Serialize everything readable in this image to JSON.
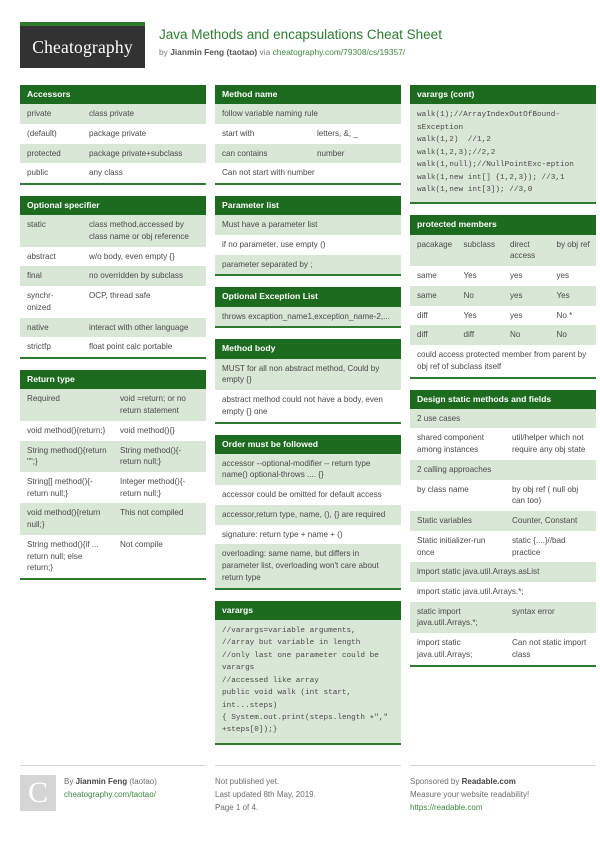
{
  "header": {
    "logo_text": "Cheatography",
    "title": "Java Methods and encapsulations Cheat Sheet",
    "by_prefix": "by ",
    "author": "Jianmin Feng (taotao)",
    "via": " via ",
    "source_url": "cheatography.com/79308/cs/19357/"
  },
  "columns": [
    {
      "blocks": [
        {
          "title": "Accessors",
          "type": "kv",
          "rows": [
            [
              "private",
              "class private"
            ],
            [
              "(default)",
              "package private"
            ],
            [
              "protected",
              "package private+subclass"
            ],
            [
              "public",
              "any class"
            ]
          ]
        },
        {
          "title": "Optional specifier",
          "type": "kv",
          "rows": [
            [
              "static",
              "class method,accessed by class name or obj reference"
            ],
            [
              "abstract",
              "w/o body, even empty {}"
            ],
            [
              "final",
              "no overridden by subclass"
            ],
            [
              "synchr-onized",
              "OCP, thread safe"
            ],
            [
              "native",
              "interact with other language"
            ],
            [
              "strictfp",
              "float point calc portable"
            ]
          ]
        },
        {
          "title": "Return type",
          "type": "half",
          "rows": [
            [
              "Required",
              "void =return; or no return statement"
            ],
            [
              "void method(){return;}",
              "void method(){}"
            ],
            [
              "String method(){return \"\";}",
              "String method(){-return null;}"
            ],
            [
              "String[] method(){-return null;}",
              "Integer method(){-return null;}"
            ],
            [
              "void method(){return null;}",
              "This not compiled"
            ],
            [
              "String method(){if ... return null; else return;}",
              "Not compile"
            ]
          ]
        }
      ]
    },
    {
      "blocks": [
        {
          "title": "Method name",
          "type": "mixed",
          "rows": [
            [
              "follow variable naming rule",
              ""
            ],
            [
              "start with",
              "letters, &, _"
            ],
            [
              "can contains",
              "number"
            ],
            [
              "Can not start with number",
              ""
            ]
          ]
        },
        {
          "title": "Parameter list",
          "type": "full",
          "rows": [
            [
              "Must have a parameter list"
            ],
            [
              "if no parameter, use empty ()"
            ],
            [
              "parameter separated by ;"
            ]
          ]
        },
        {
          "title": "Optional Exception List",
          "type": "full",
          "rows": [
            [
              "throws excaption_name1,exception_name-2,..."
            ]
          ]
        },
        {
          "title": "Method body",
          "type": "full",
          "rows": [
            [
              "MUST for all non abstract method, Could by empty {}"
            ],
            [
              "abstract method could not have a body, even empty {} one"
            ]
          ]
        },
        {
          "title": "Order must be followed",
          "type": "full",
          "rows": [
            [
              "accessor --optional-modifier -- return type name() optional-throws .... {}"
            ],
            [
              "accessor could be omitted for default access"
            ],
            [
              "accessor,return type, name, (), {} are required"
            ],
            [
              "signature: return type + name + ()"
            ],
            [
              "overloading: same name, but differs in parameter list, overloading won't care about return type"
            ]
          ]
        },
        {
          "title": "varargs",
          "type": "code",
          "code": "//varargs=variable arguments,\n//array but variable in length\n//only last one parameter could be varargs\n//accessed like array\npublic void walk (int start, int...steps)\n{ System.out.print(steps.length +\",\" +steps[0]);}"
        }
      ]
    },
    {
      "blocks": [
        {
          "title": "varargs (cont)",
          "type": "code",
          "code": "walk(1);//ArrayIndexOutOfBound-sException\nwalk(1,2)  //1,2\nwalk(1,2,3);//2,2\nwalk(1,null);//NullPointExc-eption\nwalk(1,new int[] {1,2,3}); //3,1\nwalk(1,new int[3]); //3,0"
        },
        {
          "title": "protected members",
          "type": "quad",
          "header_row": [
            "pacakage",
            "subclass",
            "direct access",
            "by obj ref"
          ],
          "rows": [
            [
              "same",
              "Yes",
              "yes",
              "yes"
            ],
            [
              "same",
              "No",
              "yes",
              "Yes"
            ],
            [
              "diff",
              "Yes",
              "yes",
              "No *"
            ],
            [
              "diff",
              "diff",
              "No",
              "No"
            ]
          ],
          "note": "could access protected member from parent by obj ref of subclass itself"
        },
        {
          "title": "Design static methods and fields",
          "type": "mixed2",
          "rows": [
            [
              "2 use cases",
              ""
            ],
            [
              "shared component among instances",
              "util/helper which not require any obj state"
            ],
            [
              "2 calling approaches",
              ""
            ],
            [
              "by class name",
              "by obj ref ( null obj can too)"
            ],
            [
              "Static variables",
              "Counter, Constant"
            ],
            [
              "Static initializer-run once",
              "static {....}//bad practice"
            ],
            [
              "import static java.util.Arrays.asList",
              ""
            ],
            [
              "import static java.util.Arrays.*;",
              ""
            ],
            [
              "static import java.util.Arrays.*;",
              "syntax error"
            ],
            [
              "import static java.util.Arrays;",
              "Can not static import class"
            ]
          ]
        }
      ]
    }
  ],
  "footer": {
    "avatar_letter": "C",
    "by_label": "By ",
    "author": "Jianmin Feng",
    "author_handle": " (taotao)",
    "author_url": "cheatography.com/taotao/",
    "publish_status": "Not published yet.",
    "last_updated": "Last updated 8th May, 2019.",
    "page_info": "Page 1 of 4.",
    "sponsor_prefix": "Sponsored by ",
    "sponsor_name": "Readable.com",
    "sponsor_tagline": "Measure your website readability!",
    "sponsor_url": "https://readable.com"
  }
}
